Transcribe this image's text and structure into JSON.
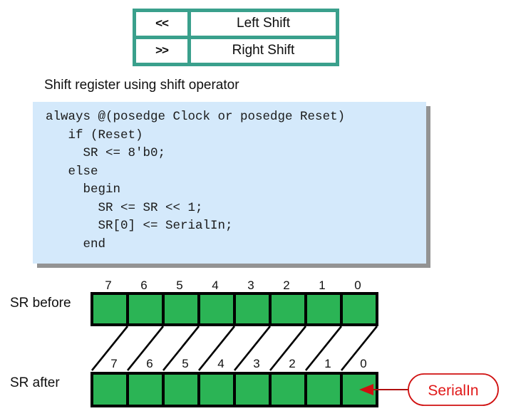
{
  "operator_table": {
    "rows": [
      {
        "symbol": "<<",
        "name": "Left Shift"
      },
      {
        "symbol": ">>",
        "name": "Right Shift"
      }
    ]
  },
  "section": {
    "heading": "Shift register using shift operator"
  },
  "code": {
    "language": "verilog",
    "text": "always @(posedge Clock or posedge Reset)\n   if (Reset)\n     SR <= 8'b0;\n   else\n     begin\n       SR <= SR << 1;\n       SR[0] <= SerialIn;\n     end",
    "background_color": "#d4e9fb"
  },
  "diagram": {
    "before_label": "SR before",
    "after_label": "SR after",
    "bit_indices_top": [
      "7",
      "6",
      "5",
      "4",
      "3",
      "2",
      "1",
      "0"
    ],
    "bit_indices_bottom": [
      "7",
      "6",
      "5",
      "4",
      "3",
      "2",
      "1",
      "0"
    ],
    "cell_color": "#2BB455",
    "callout": {
      "label": "SerialIn",
      "color": "#e01818"
    }
  }
}
